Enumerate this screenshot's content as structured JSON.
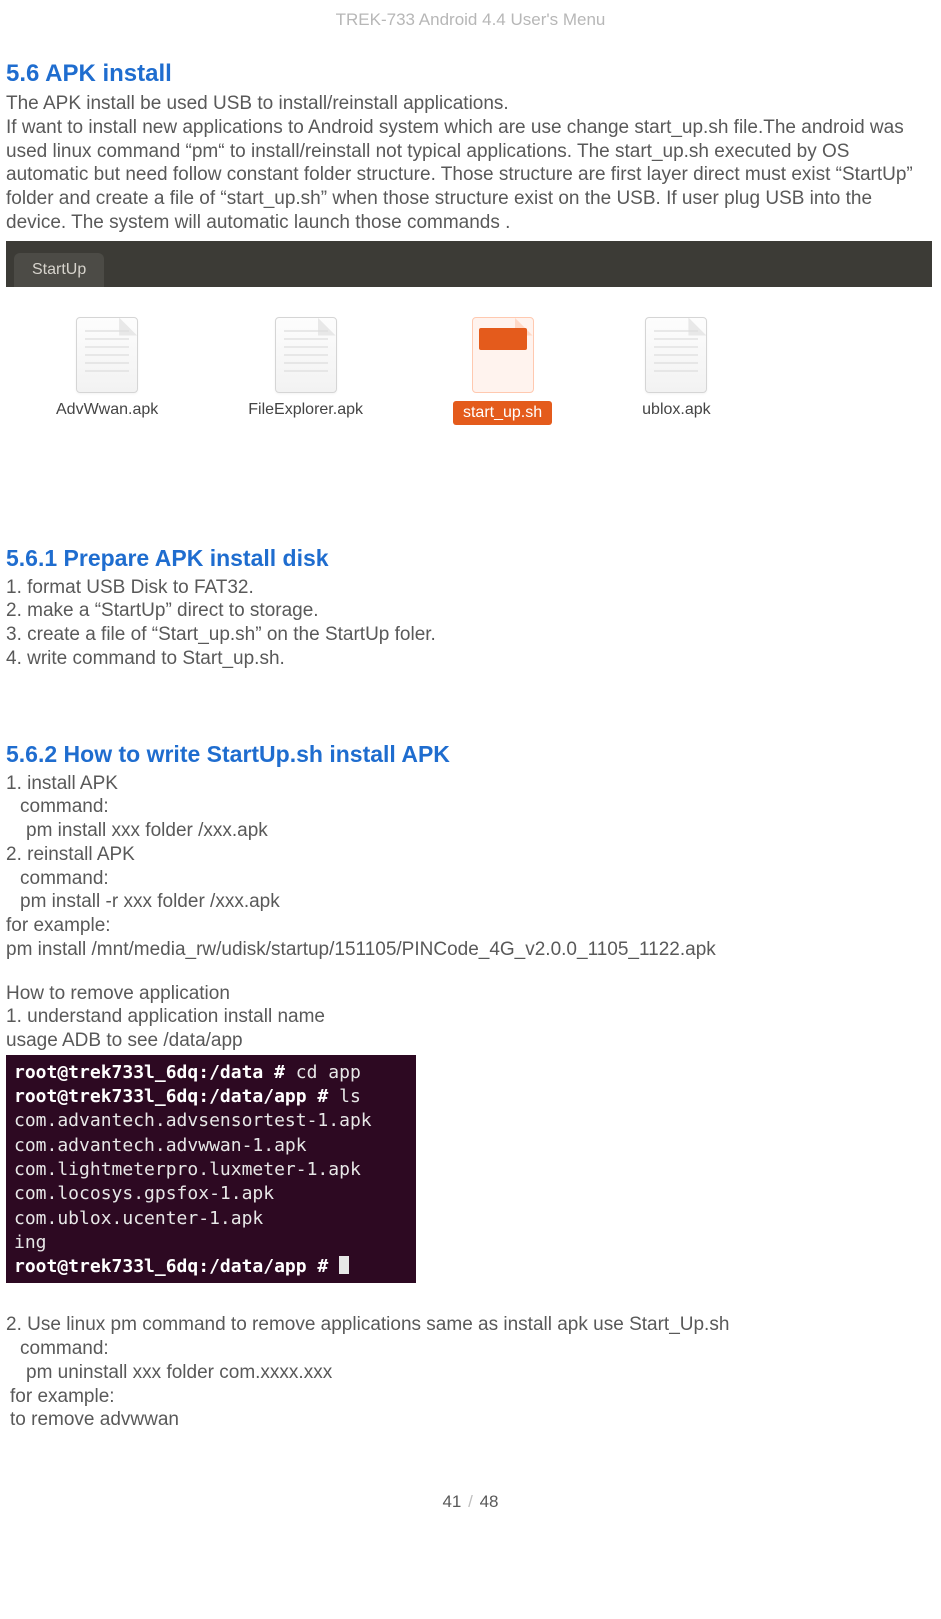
{
  "header": {
    "title": "TREK-733 Android 4.4 User's Menu"
  },
  "s56": {
    "heading": "5.6 APK install",
    "p1": " The APK install be used USB to install/reinstall applications.",
    "p2": "If want to install new applications to Android system which are use change start_up.sh file.The android was used linux command “pm“ to install/reinstall not typical applications. The start_up.sh executed by OS automatic but need follow constant folder structure. Those structure are first layer direct must exist “StartUp” folder and  create a file of “start_up.sh” when those structure exist on the USB. If user plug USB into the device. The system will automatic launch those commands ."
  },
  "filebrowser": {
    "tab": "StartUp",
    "files": [
      {
        "name": "AdvWwan.apk",
        "kind": "doc"
      },
      {
        "name": "FileExplorer.apk",
        "kind": "doc"
      },
      {
        "name": "start_up.sh",
        "kind": "sh"
      },
      {
        "name": "ublox.apk",
        "kind": "doc"
      }
    ]
  },
  "s561": {
    "heading": "5.6.1 Prepare APK install disk",
    "l1": "1. format USB Disk to FAT32.",
    "l2": "2. make a “StartUp” direct to storage.",
    "l3": "3. create a file of “Start_up.sh” on the StartUp foler.",
    "l4": "4. write command to Start_up.sh."
  },
  "s562": {
    "heading": "5.6.2 How to write StartUp.sh install APK",
    "l1": "1. install APK",
    "l2": "  command:",
    "l3": "    pm install xxx folder /xxx.apk",
    "l4": "2. reinstall APK",
    "l5": "  command:",
    "l6": "  pm install -r xxx folder /xxx.apk",
    "l7": "for example:",
    "l8": "pm install /mnt/media_rw/udisk/startup/151105/PINCode_4G_v2.0.0_1105_1122.apk",
    "l9": "How to remove application",
    "l10": "1. understand application install name",
    "l11": " usage ADB to see /data/app"
  },
  "terminal": {
    "line1_prompt": "root@trek733l_6dq:/data # ",
    "line1_cmd": "cd app",
    "line2_prompt": "root@trek733l_6dq:/data/app # ",
    "line2_cmd": "ls",
    "line3": "com.advantech.advsensortest-1.apk",
    "line4": "com.advantech.advwwan-1.apk",
    "line5": "com.lightmeterpro.luxmeter-1.apk",
    "line6": "com.locosys.gpsfox-1.apk",
    "line7": "com.ublox.ucenter-1.apk",
    "line8": "ing",
    "line9_prompt": "root@trek733l_6dq:/data/app # "
  },
  "s562b": {
    "l1": "2. Use linux pm command to remove applications same as install apk use Start_Up.sh",
    "l2": "   command:",
    "l3": "    pm uninstall xxx folder com.xxxx.xxx",
    "l4": " for example:",
    "l5": " to remove advwwan"
  },
  "footer": {
    "page": "41",
    "sep": "/",
    "total": "48"
  }
}
